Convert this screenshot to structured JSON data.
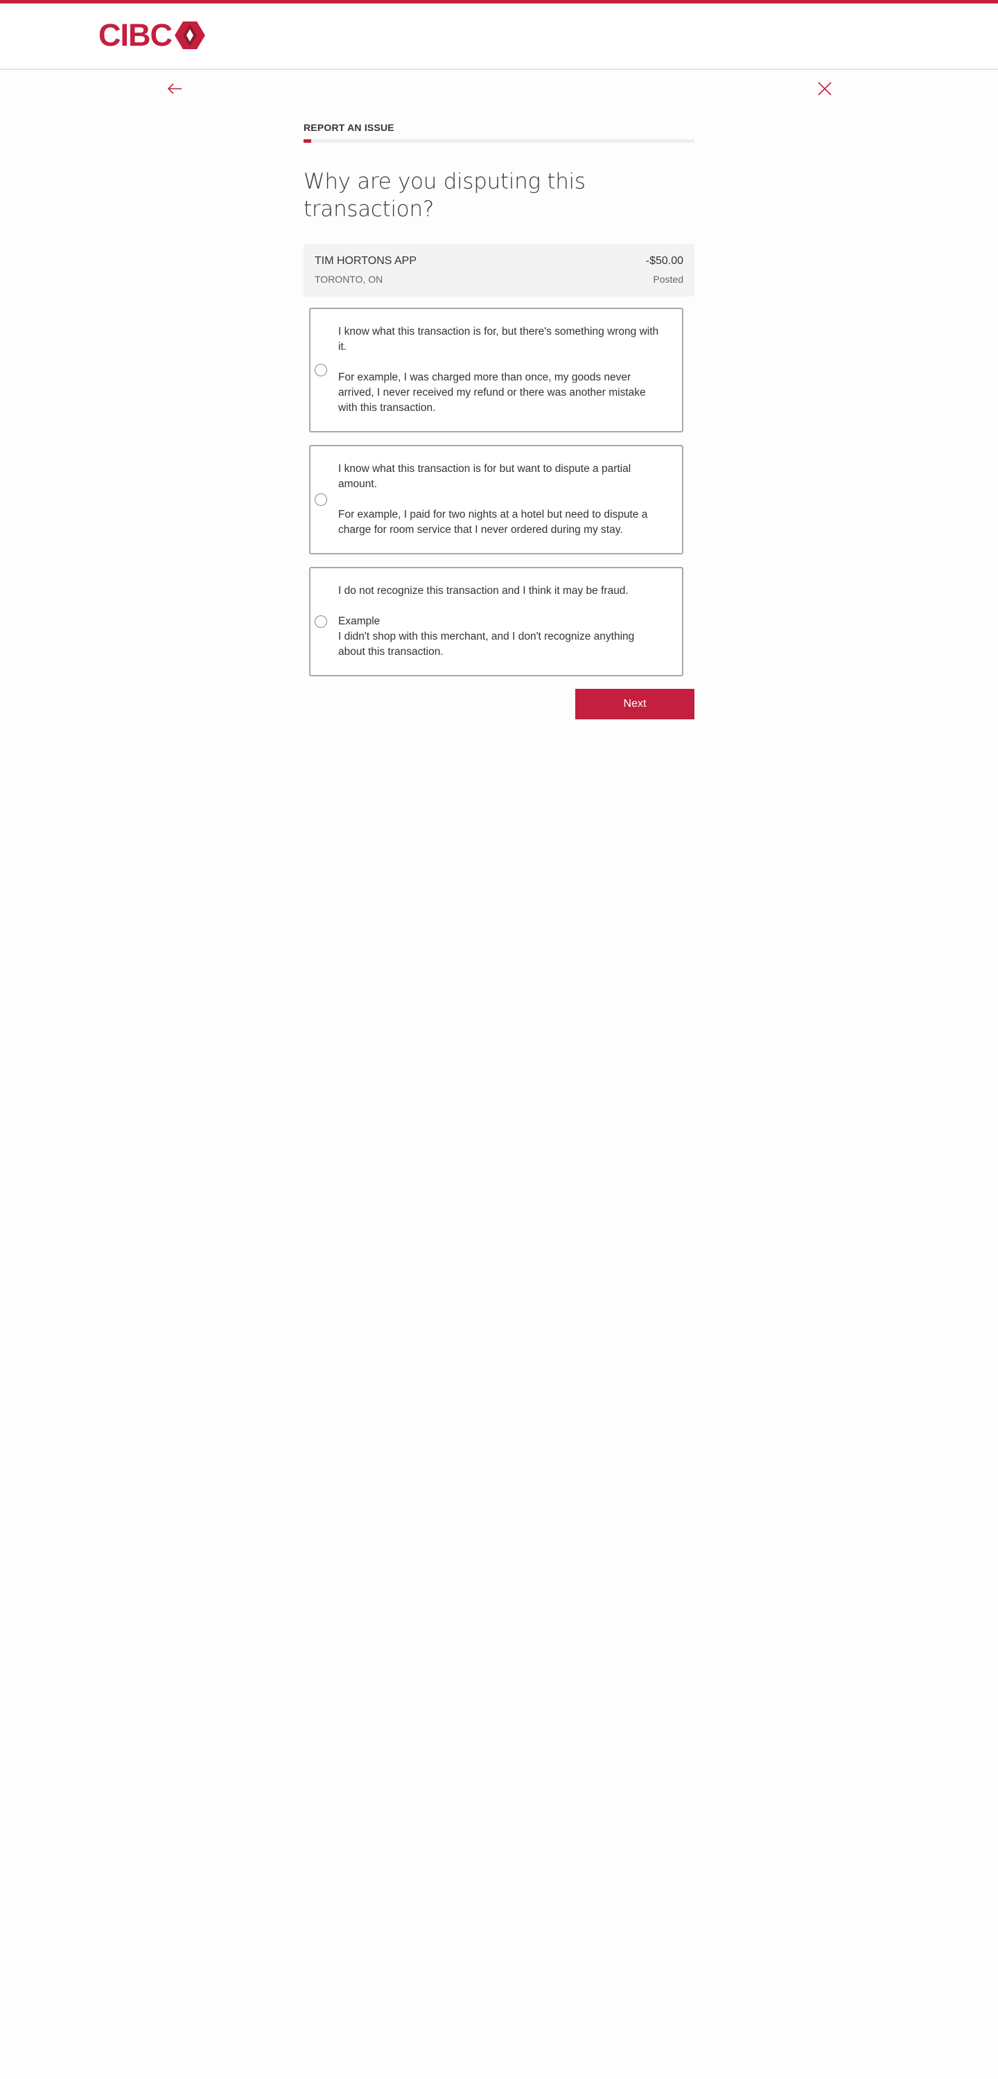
{
  "brand": {
    "name": "CIBC",
    "accent_color": "#c41f3e"
  },
  "nav": {
    "back_icon": "arrow-left-icon",
    "close_icon": "close-icon"
  },
  "flow": {
    "eyebrow": "REPORT AN ISSUE",
    "progress_fraction": 0.02
  },
  "page": {
    "title": "Why are you disputing this transaction?"
  },
  "transaction": {
    "merchant": "TIM HORTONS APP",
    "location": "TORONTO, ON",
    "amount": "-$50.00",
    "status": "Posted"
  },
  "options": [
    {
      "primary": "I know what this transaction is for, but there's something wrong with it.",
      "example_heading": "",
      "example": "For example, I was charged more than once, my goods never arrived, I never received my refund or there was another mistake with this transaction."
    },
    {
      "primary": "I know what this transaction is for but want to dispute a partial amount.",
      "example_heading": "",
      "example": "For example, I paid for two nights at a hotel but need to dispute a charge for room service that I never ordered during my stay."
    },
    {
      "primary": "I do not recognize this transaction and I think it may be fraud.",
      "example_heading": "Example",
      "example": "I didn't shop with this merchant, and I don't recognize anything about this transaction."
    }
  ],
  "actions": {
    "next_label": "Next"
  }
}
